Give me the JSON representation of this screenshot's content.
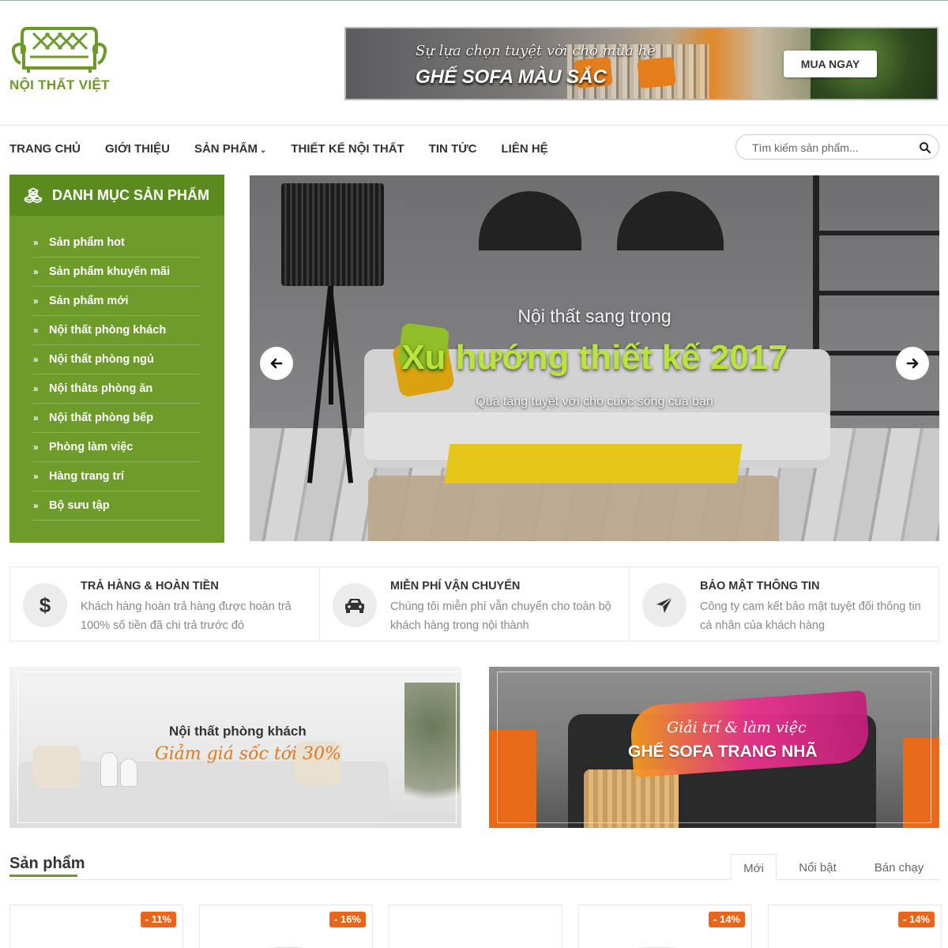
{
  "brand": {
    "name": "NỘI THẤT VIỆT",
    "color": "#6c9a2a"
  },
  "top_banner": {
    "script": "Sự lựa chọn tuyệt vời cho mùa hè",
    "title": "GHẾ SOFA MÀU SẮC",
    "button": "MUA NGAY"
  },
  "nav": {
    "items": [
      "TRANG CHỦ",
      "GIỚI THIỆU",
      "SẢN PHẨM",
      "THIẾT KẾ NỘI THẤT",
      "TIN TỨC",
      "LIÊN HỆ"
    ],
    "dropdown_item_index": 2
  },
  "search": {
    "placeholder": "Tìm kiếm sản phẩm..."
  },
  "sidebar": {
    "title": "DANH MỤC SẢN PHẨM",
    "color": "#6e9c2a",
    "items": [
      "Sản phẩm hot",
      "Sản phẩm khuyến mãi",
      "Sản phẩm mới",
      "Nội thất phòng khách",
      "Nội thất phòng ngủ",
      "Nội thâts phòng ăn",
      "Nội thất phòng bếp",
      "Phòng làm việc",
      "Hàng trang trí",
      "Bộ sưu tập"
    ]
  },
  "hero": {
    "subtitle": "Nội thất sang trọng",
    "title": "Xu hướng thiết kế 2017",
    "caption": "Quà tặng tuyệt vời cho cuộc sống của bạn",
    "title_color": "#b9e43a"
  },
  "services": [
    {
      "icon": "dollar-icon",
      "title": "TRẢ HÀNG & HOÀN TIỀN",
      "desc": "Khách hàng hoàn trả hàng được hoàn trả 100% số tiền đã chi trả trước đó"
    },
    {
      "icon": "car-icon",
      "title": "MIỄN PHÍ VẬN CHUYỂN",
      "desc": "Chúng tôi miễn phí vẫn chuyển cho toàn bộ khách hàng trong nội thành"
    },
    {
      "icon": "paper-plane-icon",
      "title": "BẢO MẬT THÔNG TIN",
      "desc": "Công ty cam kết bảo mật tuyệt đối thông tin cá nhân của khách hàng"
    }
  ],
  "promos": [
    {
      "line1": "Nội thất phòng khách",
      "line2": "Giảm giá sốc tới 30%"
    },
    {
      "line1": "Giải trí & làm việc",
      "line2": "GHẾ SOFA TRANG NHÃ"
    }
  ],
  "products": {
    "title": "Sản phẩm",
    "tabs": [
      "Mới",
      "Nổi bật",
      "Bán chạy"
    ],
    "active_tab": 0,
    "badges": [
      "- 11%",
      "- 16%",
      "",
      "- 14%",
      "- 14%"
    ],
    "badge_color": "#e8651a"
  }
}
